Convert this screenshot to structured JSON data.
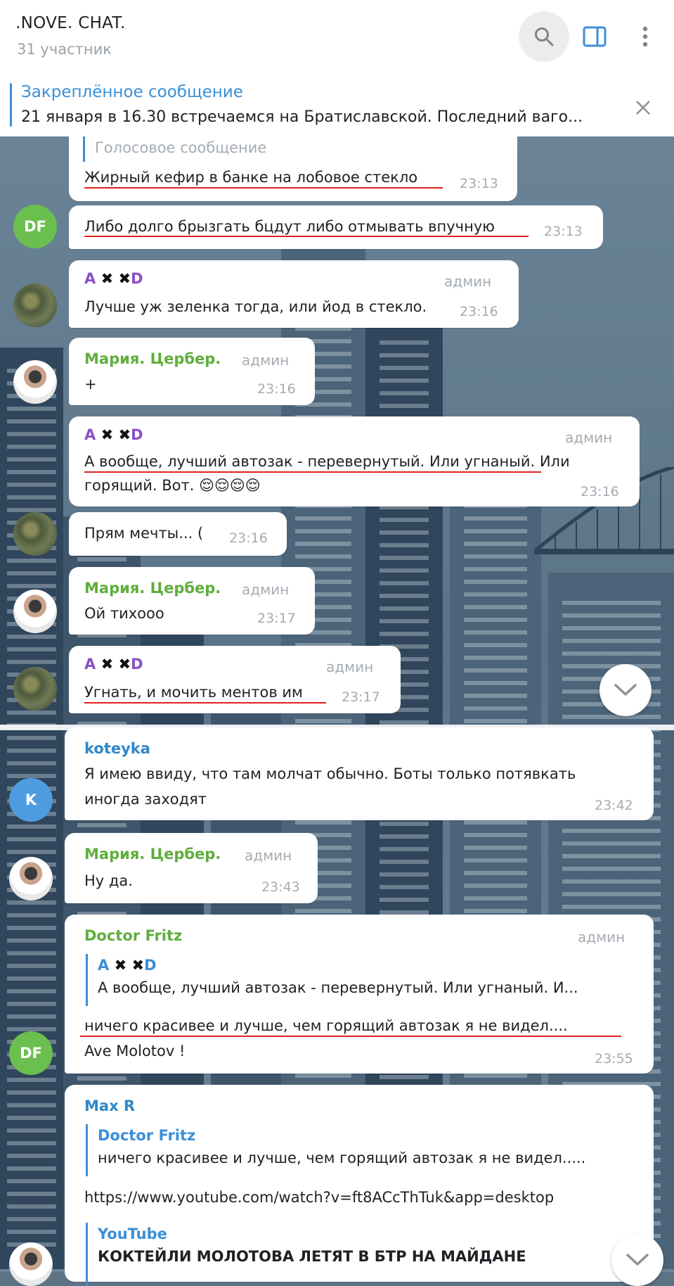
{
  "header": {
    "title": ".NOVE. CHAT.",
    "subtitle": "31 участник"
  },
  "pinned": {
    "title": "Закреплённое сообщение",
    "text": "21 января в 16.30 встречаемся на Братиславской. Последний ваго..."
  },
  "messages": [
    {
      "reply_label": "Голосовое сообщение",
      "text": "Жирный кефир в банке на лобовое стекло",
      "time": "23:13"
    },
    {
      "avatar": "DF",
      "text": "Либо долго брызгать бцдут либо отмывать впучную",
      "time": "23:13"
    },
    {
      "sender_a": "A",
      "sender_x1": "✖",
      "sender_x2": "✖",
      "sender_d": "D",
      "role": "админ",
      "text": "Лучше уж зеленка тогда, или йод в стекло.",
      "time": "23:16"
    },
    {
      "sender": "Мария. Цербер.",
      "role": "админ",
      "text": "+",
      "time": "23:16"
    },
    {
      "sender_a": "A",
      "sender_x1": "✖",
      "sender_x2": "✖",
      "sender_d": "D",
      "role": "админ",
      "text1": "А вообще, лучший автозак - перевернутый. Или угнаный. Или",
      "text2": "горящий. Вот. 😌😌😌😌",
      "time": "23:16"
    },
    {
      "text": "Прям мечты... (",
      "time": "23:16"
    },
    {
      "sender": "Мария. Цербер.",
      "role": "админ",
      "text": "Ой тихооо",
      "time": "23:17"
    },
    {
      "sender_a": "A",
      "sender_x1": "✖",
      "sender_x2": "✖",
      "sender_d": "D",
      "role": "админ",
      "text": "Угнать, и мочить ментов им",
      "time": "23:17"
    },
    {
      "sender": "koteyka",
      "avatar": "K",
      "text1": "Я имею ввиду, что там молчат обычно. Боты только потявкать",
      "text2": "иногда заходят",
      "time": "23:42"
    },
    {
      "sender": "Мария. Цербер.",
      "role": "админ",
      "text": "Ну да.",
      "time": "23:43"
    },
    {
      "sender": "Doctor Fritz",
      "avatar": "DF",
      "role": "админ",
      "quote_a": "A",
      "quote_x1": "✖",
      "quote_x2": "✖",
      "quote_d": "D",
      "quote_text": "А вообще, лучший автозак - перевернутый. Или угнаный. И...",
      "text1": "ничего красивее и лучше, чем горящий автозак я не видел....",
      "text2": "Ave Molotov !",
      "time": "23:55"
    },
    {
      "sender": "Max R",
      "quote_name": "Doctor Fritz",
      "quote_text": "ничего красивее и лучше, чем горящий автозак я не видел.....",
      "link": "https://www.youtube.com/watch?v=ft8ACcThTuk&app=desktop",
      "preview_site": "YouTube",
      "preview_title": "КОКТЕЙЛИ МОЛОТОВА ЛЕТЯТ В БТР НА МАЙДАНЕ"
    }
  ],
  "icons": {
    "search": "search-icon",
    "panel": "sidebar-toggle-icon",
    "more": "more-vertical-icon",
    "close": "close-icon",
    "scroll_down": "chevron-down-icon"
  },
  "colors": {
    "accent": "#3a8fd8",
    "green_name": "#5fae3c",
    "purple_name": "#8a4fc6",
    "underline": "#e0201c"
  }
}
